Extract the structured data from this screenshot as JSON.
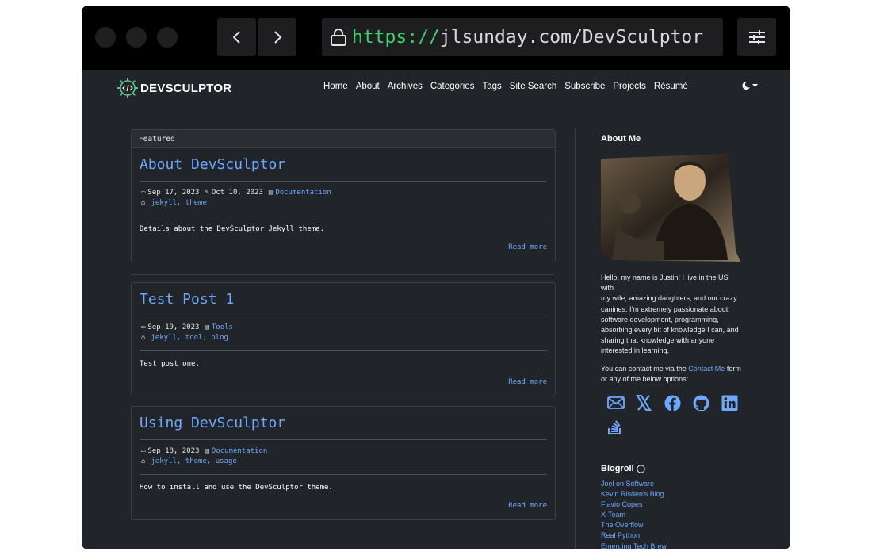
{
  "browser": {
    "url_scheme": "https://",
    "url_host": "jlsunday.com/DevSculptor",
    "back_icon": "chevron-left-icon",
    "forward_icon": "chevron-right-icon",
    "lock_icon": "lock-icon",
    "settings_icon": "sliders-icon"
  },
  "site": {
    "logo_text": "DEVSCULPTOR",
    "nav": [
      "Home",
      "About",
      "Archives",
      "Categories",
      "Tags",
      "Site Search",
      "Subscribe",
      "Projects",
      "Résumé"
    ],
    "theme_toggle_icon": "moon-stars-icon"
  },
  "featured": {
    "header": "Featured",
    "title": "About DevSculptor",
    "date": "Sep 17, 2023",
    "updated": "Oct 10, 2023",
    "category": "Documentation",
    "tags": "jekyll, theme",
    "excerpt": "Details about the DevSculptor Jekyll theme.",
    "read_more": "Read more"
  },
  "posts": [
    {
      "title": "Test Post 1",
      "date": "Sep 19, 2023",
      "category": "Tools",
      "tags": "jekyll, tool, blog",
      "excerpt": "Test post one.",
      "read_more": "Read more"
    },
    {
      "title": "Using DevSculptor",
      "date": "Sep 18, 2023",
      "category": "Documentation",
      "tags": "jekyll, theme, usage",
      "excerpt": "How to install and use the DevSculptor theme.",
      "read_more": "Read more"
    }
  ],
  "sidebar": {
    "about_heading": "About Me",
    "bio_lines": [
      "Hello, my name is Justin! I live in the US with",
      "my wife, amazing daughters, and our crazy",
      "canines. I'm extremely passionate about",
      "software development, programming,",
      "absorbing every bit of knowledge I can, and",
      "sharing that knowledge with anyone",
      "interested in learning."
    ],
    "contact_prefix": "You can contact me via the",
    "contact_link": "Contact Me",
    "contact_suffix": "form",
    "contact_line2": "or any of the below options:",
    "social_icons": [
      "envelope-icon",
      "x-twitter-icon",
      "facebook-icon",
      "github-icon",
      "linkedin-icon",
      "stack-overflow-icon"
    ],
    "blogroll_heading": "Blogroll",
    "blogroll": [
      "Joel on Software",
      "Kevin Risden's Blog",
      "Flavio Copes",
      "X-Team",
      "The Overflow",
      "Real Python",
      "Emerging Tech Brew"
    ]
  }
}
